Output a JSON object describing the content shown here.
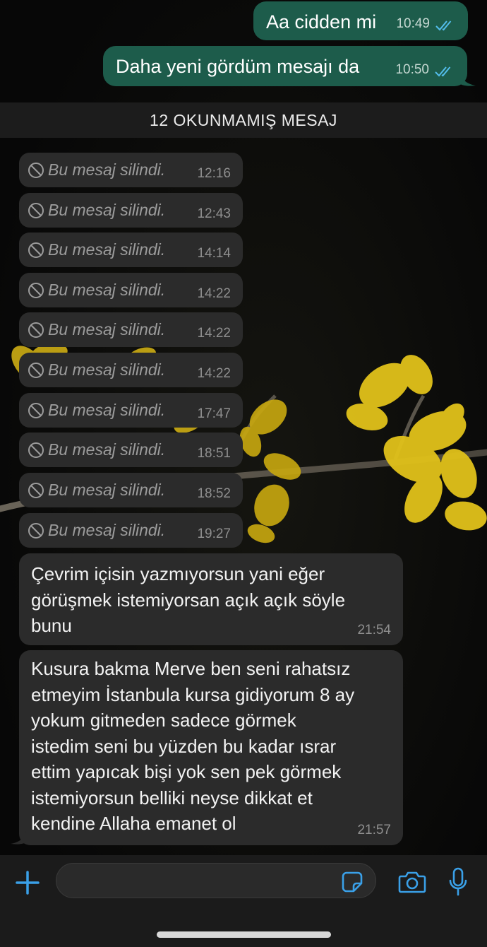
{
  "colors": {
    "outgoing_bubble": "#1d5c4b",
    "incoming_bubble": "#2b2b2b",
    "read_ticks": "#53bdeb",
    "accent_blue": "#3aa0e8"
  },
  "outgoing": [
    {
      "text": "Aa cidden mi",
      "time": "10:49",
      "status": "read-double-check-icon"
    },
    {
      "text": "Daha yeni gördüm mesajı da",
      "time": "10:50",
      "status": "read-double-check-icon"
    }
  ],
  "unread_banner": "12 OKUNMAMIŞ MESAJ",
  "deleted_messages": [
    {
      "text": "Bu mesaj silindi.",
      "time": "12:16"
    },
    {
      "text": "Bu mesaj silindi.",
      "time": "12:43"
    },
    {
      "text": "Bu mesaj silindi.",
      "time": "14:14"
    },
    {
      "text": "Bu mesaj silindi.",
      "time": "14:22"
    },
    {
      "text": "Bu mesaj silindi.",
      "time": "14:22"
    },
    {
      "text": "Bu mesaj silindi.",
      "time": "14:22"
    },
    {
      "text": "Bu mesaj silindi.",
      "time": "17:47"
    },
    {
      "text": "Bu mesaj silindi.",
      "time": "18:51"
    },
    {
      "text": "Bu mesaj silindi.",
      "time": "18:52"
    },
    {
      "text": "Bu mesaj silindi.",
      "time": "19:27"
    }
  ],
  "incoming": [
    {
      "lines": [
        "Çevrim içisin yazmıyorsun yani eğer",
        "görüşmek istemiyorsan açık açık söyle",
        "bunu"
      ],
      "time": "21:54"
    },
    {
      "lines": [
        "Kusura bakma Merve ben seni rahatsız",
        "etmeyim İstanbula kursa gidiyorum 8 ay",
        "yokum gitmeden sadece görmek",
        "istedim seni bu yüzden bu kadar ısrar",
        "ettim yapıcak bişi yok sen pek görmek",
        "istemiyorsun belliki neyse dikkat et",
        "kendine Allaha emanet ol"
      ],
      "time": "21:57"
    }
  ],
  "input_bar": {
    "add_icon": "plus-icon",
    "message_value": "",
    "sticker_icon": "sticker-icon",
    "camera_icon": "camera-icon",
    "mic_icon": "microphone-icon"
  }
}
